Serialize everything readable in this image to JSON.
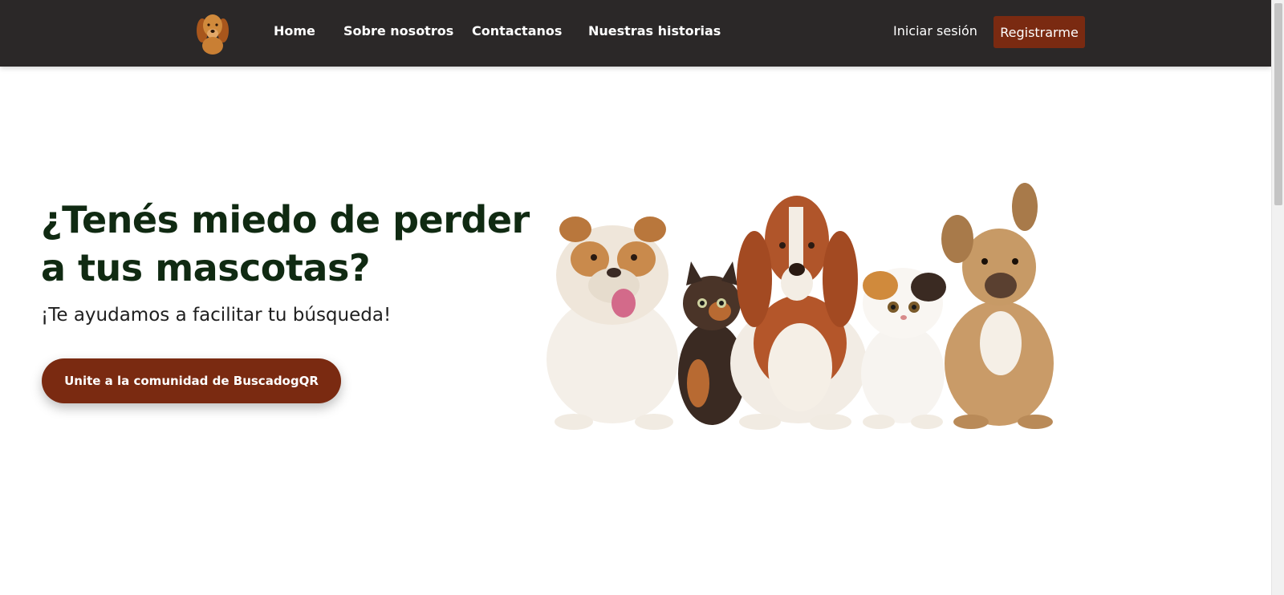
{
  "navbar": {
    "logo_icon": "golden-retriever-logo",
    "links": [
      {
        "label": "Home"
      },
      {
        "label": "Sobre nosotros"
      },
      {
        "label": "Contactanos"
      },
      {
        "label": "Nuestras historias"
      }
    ],
    "login_label": "Iniciar sesión",
    "register_label": "Registrarme"
  },
  "hero": {
    "title": "¿Tenés miedo de perder a tus mascotas?",
    "subtitle": "¡Te ayudamos a facilitar tu búsqueda!",
    "cta_label": "Unite a la comunidad de BuscadogQR",
    "image_icon": "pets-group-image"
  },
  "colors": {
    "navbar_bg": "#2b2828",
    "accent": "#7a2a11",
    "title_color": "#102a12"
  }
}
